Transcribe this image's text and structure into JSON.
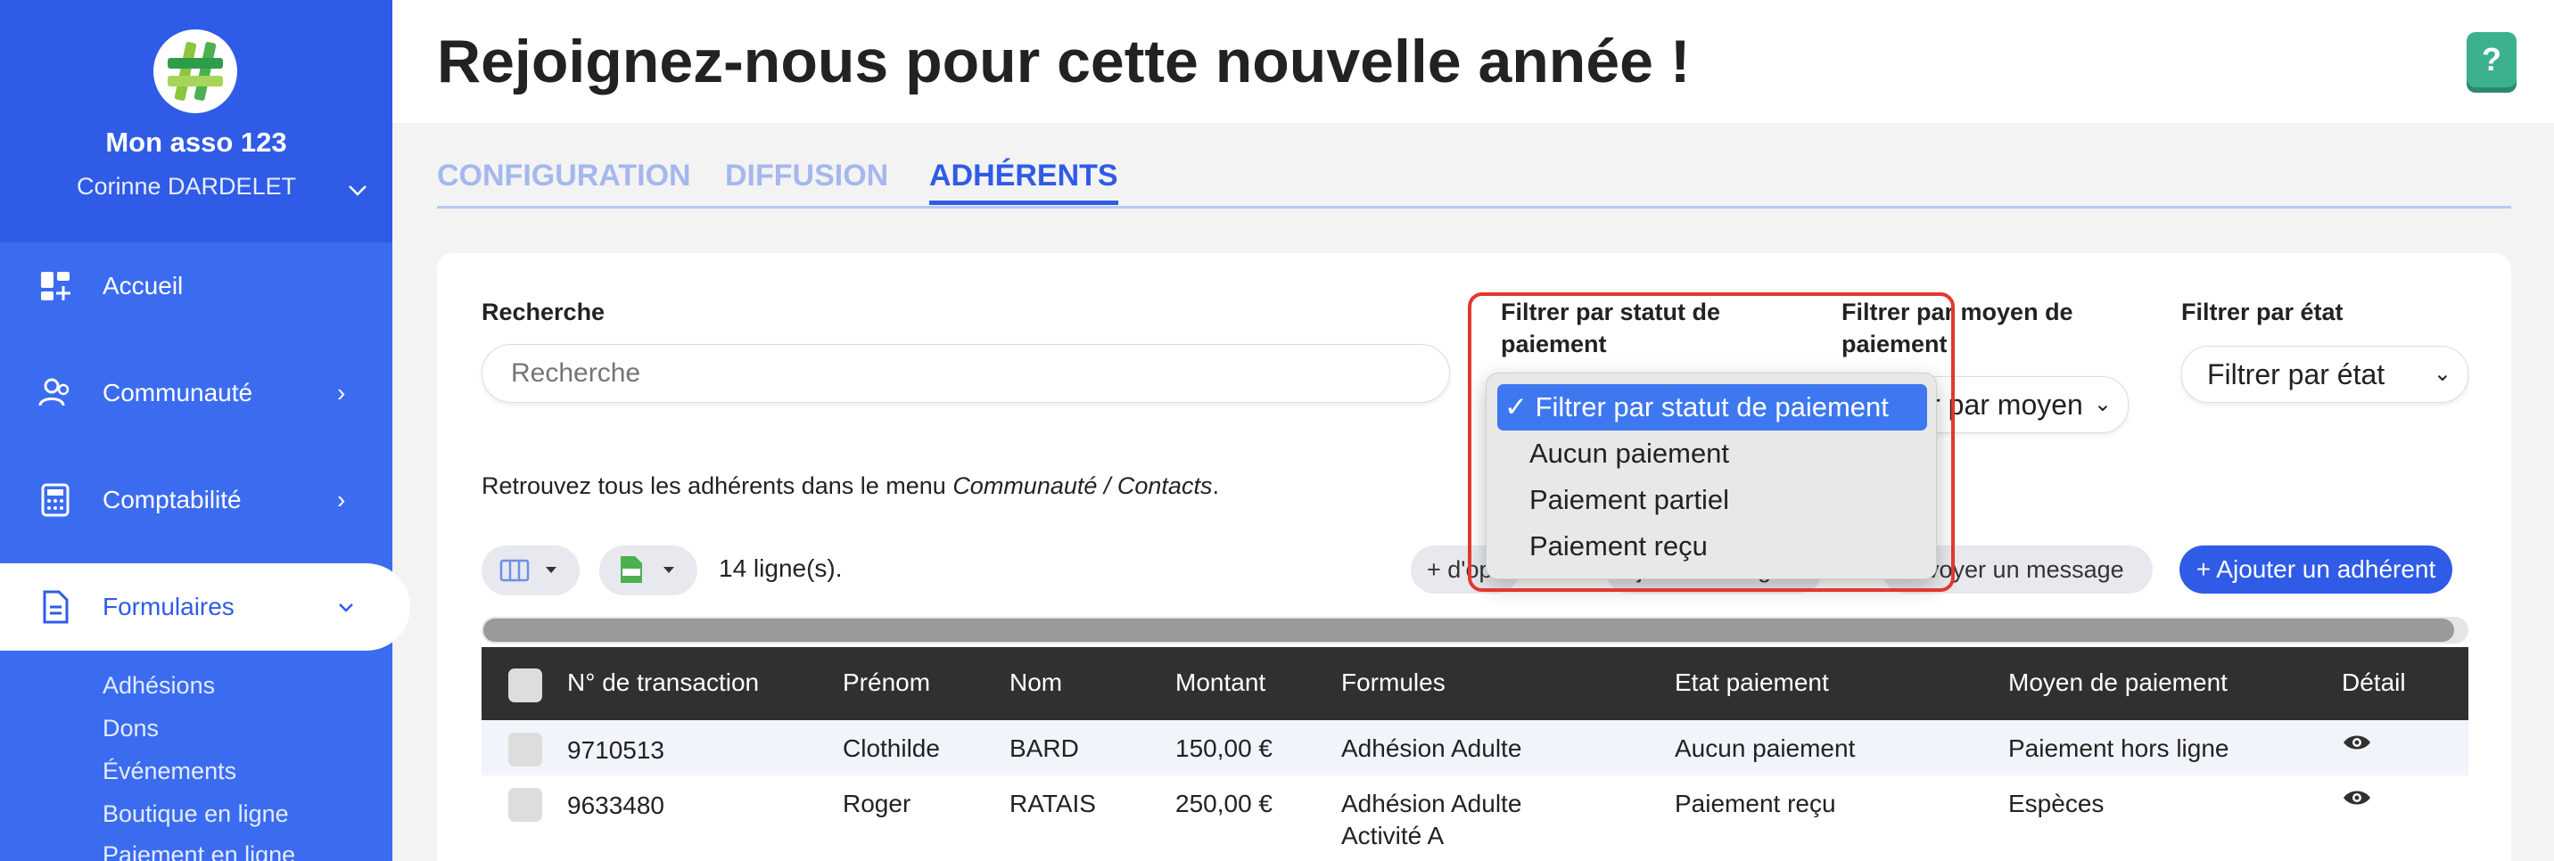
{
  "sidebar": {
    "org_name": "Mon asso 123",
    "user_name": "Corinne DARDELET",
    "nav": [
      {
        "label": "Accueil",
        "icon": "dashboard-icon"
      },
      {
        "label": "Communauté",
        "icon": "users-icon"
      },
      {
        "label": "Comptabilité",
        "icon": "calculator-icon"
      },
      {
        "label": "Formulaires",
        "icon": "document-icon"
      }
    ],
    "subitems": [
      "Adhésions",
      "Dons",
      "Événements",
      "Boutique en ligne",
      "Paiement en ligne"
    ]
  },
  "header": {
    "title": "Rejoignez-nous pour cette nouvelle année !",
    "help": "?"
  },
  "tabs": [
    {
      "label": "CONFIGURATION",
      "active": false
    },
    {
      "label": "DIFFUSION",
      "active": false
    },
    {
      "label": "ADHÉRENTS",
      "active": true
    }
  ],
  "filters": {
    "search_label": "Recherche",
    "search_placeholder": "Recherche",
    "statut_label_line1": "Filtrer par statut de",
    "statut_label_line2": "paiement",
    "moyen_label_line1": "Filtrer par moyen de",
    "moyen_label_line2": "paiement",
    "moyen_value": "Filtrer par moyen",
    "etat_label": "Filtrer par état",
    "etat_value": "Filtrer par état"
  },
  "info": {
    "prefix": "Retrouvez tous les adhérents dans le menu ",
    "emphasis": "Communauté / Contacts",
    "suffix": "."
  },
  "toolbar": {
    "row_count": "14 ligne(s).",
    "options_btn": "+ d'options",
    "tags_btn": "Ajouter un tag",
    "message_btn": "Envoyer un message",
    "add_btn": "+ Ajouter un adhérent"
  },
  "table": {
    "headers": [
      "N° de transaction",
      "Prénom",
      "Nom",
      "Montant",
      "Formules",
      "Etat paiement",
      "Moyen de paiement",
      "Détail"
    ],
    "rows": [
      {
        "transaction": "9710513",
        "prenom": "Clothilde",
        "nom": "BARD",
        "montant": "150,00 €",
        "formule1": "Adhésion Adulte",
        "formule2": "",
        "etat": "Aucun paiement",
        "moyen": "Paiement hors ligne"
      },
      {
        "transaction": "9633480",
        "prenom": "Roger",
        "nom": "RATAIS",
        "montant": "250,00 €",
        "formule1": "Adhésion Adulte",
        "formule2": "Activité A",
        "etat": "Paiement reçu",
        "moyen": "Espèces"
      }
    ]
  },
  "dropdown": {
    "options": [
      "Filtrer par statut de paiement",
      "Aucun paiement",
      "Paiement partiel",
      "Paiement reçu"
    ],
    "selected_mark": "✓"
  },
  "colors": {
    "primary": "#2f5be6",
    "sidebar": "#3b6cf0",
    "highlight": "#e2382f",
    "help": "#3cb18d"
  }
}
